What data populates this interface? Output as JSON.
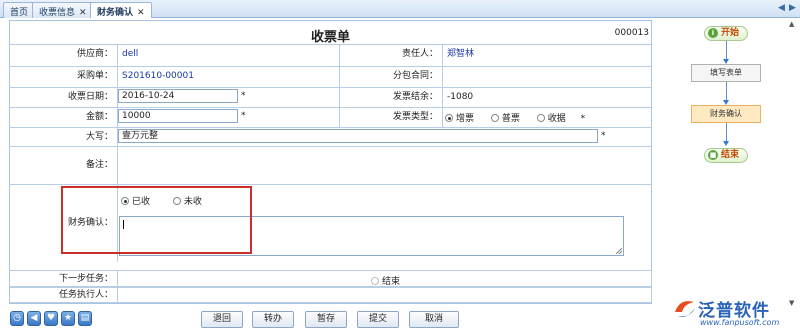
{
  "tabs": {
    "home": "首页",
    "receipt_info": "收票信息",
    "finance_confirm": "财务确认",
    "close": "✕"
  },
  "form": {
    "title": "收票单",
    "doc_no": "000013",
    "supplier_label": "供应商：",
    "supplier_value": "dell",
    "responsible_label": "责任人：",
    "responsible_value": "郑智林",
    "purchase_label": "采购单：",
    "purchase_value": "S201610-00001",
    "subcontract_label": "分包合同：",
    "subcontract_value": "",
    "date_label": "收票日期：",
    "date_value": "2016-10-24",
    "balance_label": "发票结余：",
    "balance_value": "-1080",
    "amount_label": "金额：",
    "amount_value": "10000",
    "invoice_type_label": "发票类型：",
    "invoice_types": [
      "增票",
      "普票",
      "收据"
    ],
    "capital_label": "大写：",
    "capital_value": "壹万元整",
    "remark_label": "备注：",
    "finance_label": "财务确认：",
    "finance_options": [
      "已收",
      "未收"
    ],
    "next_task_label": "下一步任务：",
    "next_task_option": "结束",
    "executor_label": "任务执行人：",
    "required_mark": "*"
  },
  "buttons": {
    "back": "退回",
    "transfer": "转办",
    "save": "暂存",
    "submit": "提交",
    "cancel": "取消"
  },
  "flow": {
    "start": "开始",
    "fill_form": "填写表单",
    "finance_confirm": "财务确认",
    "end": "结束"
  },
  "logo": {
    "name": "泛普软件",
    "url": "www.fanpusoft.com"
  },
  "colors": {
    "accent": "#2a63b8",
    "highlight_box": "#c9302c",
    "current_step": "#ffe9c2"
  }
}
